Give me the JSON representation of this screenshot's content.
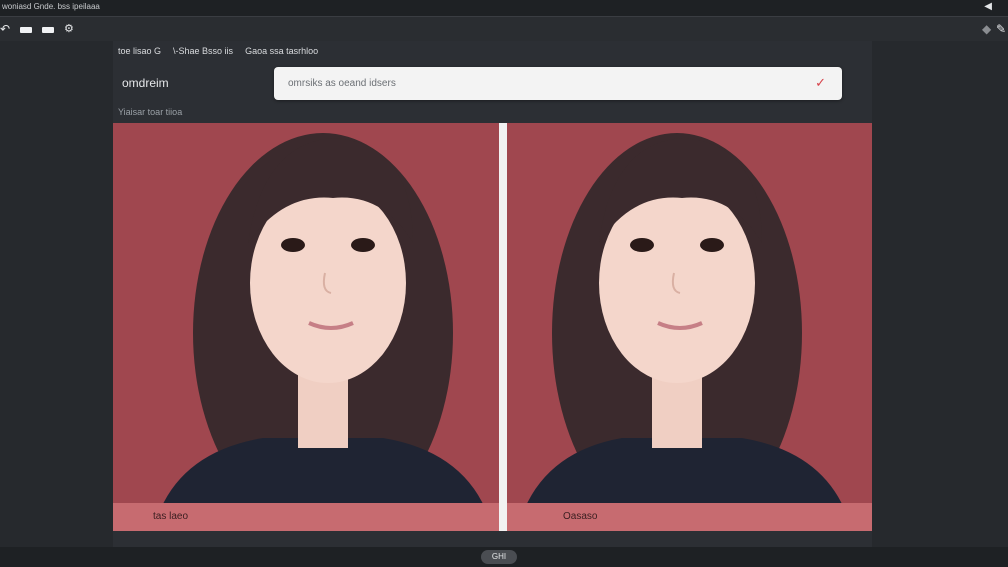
{
  "window": {
    "title": "woniasd Gnde. bss ipeilaaa"
  },
  "toolbar": {
    "icons": [
      "back-arrow-icon",
      "minus-icon",
      "minus-icon",
      "settings-icon"
    ],
    "right_icons": [
      "diamond-icon",
      "pen-icon"
    ]
  },
  "breadcrumb": [
    "toe lisao G",
    "\\-Shae Bsso iis",
    "Gaoa ssa tasrhloo"
  ],
  "app": {
    "title": "omdreim"
  },
  "search": {
    "value": "omrsiks as oeand idsers"
  },
  "section": {
    "label": "Yiaisar toar tiioa"
  },
  "panels": [
    {
      "caption": "tas laeo"
    },
    {
      "caption": "Oasaso"
    }
  ],
  "bottom": {
    "button_label": "GHI"
  },
  "colors": {
    "accent": "#d7424a",
    "panel_bg": "#a85459",
    "caption_bg": "#c76b70"
  }
}
